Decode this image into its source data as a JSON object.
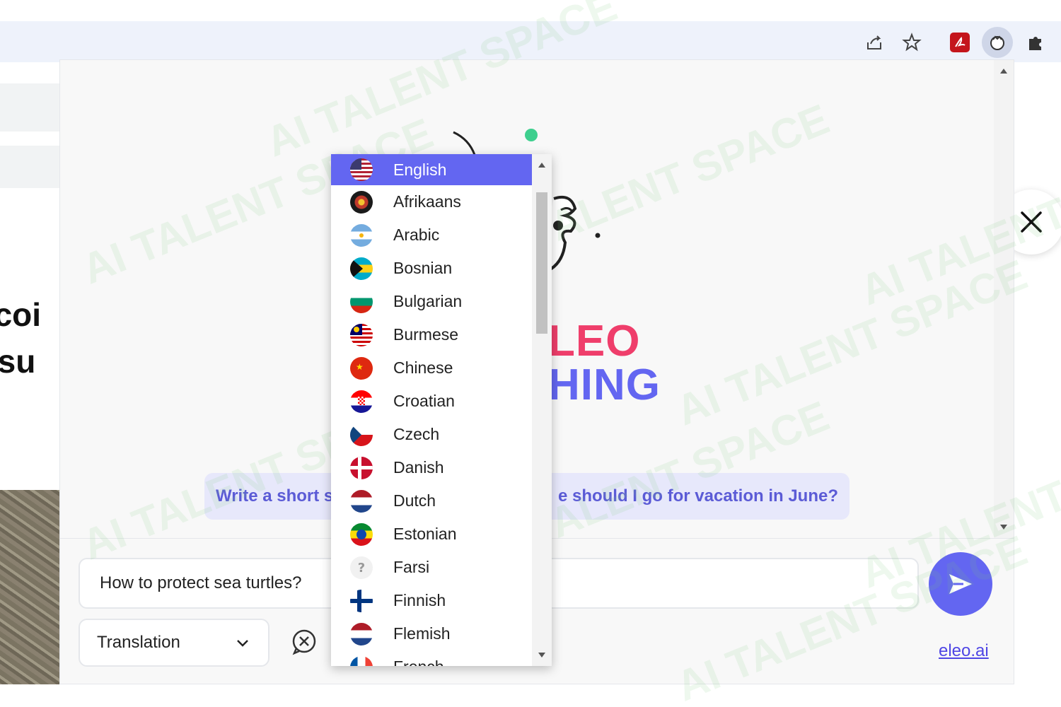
{
  "colors": {
    "accent": "#6366f1",
    "brand_red": "#ef3e6b",
    "chip_bg": "#e7e8fb",
    "selected_item": "#6366f1"
  },
  "toolbar": {
    "icons": [
      "share-icon",
      "bookmark-star-icon",
      "pdf-extension-icon",
      "eleo-extension-icon",
      "extensions-puzzle-icon"
    ]
  },
  "underlying_page": {
    "heading_line1": "ecoi",
    "heading_line2": "r su"
  },
  "panel": {
    "logo_line1": "LEO",
    "logo_line2": "HING",
    "suggestion_left": "Write a short s",
    "suggestion_right": "e should I go for vacation in June?",
    "input_value": "How to protect sea turtles?",
    "mode_value": "Translation",
    "footer_link": "eleo.ai"
  },
  "language_dropdown": {
    "selected": "English",
    "options": [
      {
        "label": "English",
        "flag": "us-flag-icon"
      },
      {
        "label": "Afrikaans",
        "flag": "za-flag-icon"
      },
      {
        "label": "Arabic",
        "flag": "ar-flag-icon"
      },
      {
        "label": "Bosnian",
        "flag": "bs-flag-icon"
      },
      {
        "label": "Bulgarian",
        "flag": "bg-flag-icon"
      },
      {
        "label": "Burmese",
        "flag": "my-flag-icon"
      },
      {
        "label": "Chinese",
        "flag": "cn-flag-icon"
      },
      {
        "label": "Croatian",
        "flag": "hr-flag-icon"
      },
      {
        "label": "Czech",
        "flag": "cz-flag-icon"
      },
      {
        "label": "Danish",
        "flag": "dk-flag-icon"
      },
      {
        "label": "Dutch",
        "flag": "nl-flag-icon"
      },
      {
        "label": "Estonian",
        "flag": "ee-flag-icon"
      },
      {
        "label": "Farsi",
        "flag": "unknown-flag-icon"
      },
      {
        "label": "Finnish",
        "flag": "fi-flag-icon"
      },
      {
        "label": "Flemish",
        "flag": "be-flag-icon"
      },
      {
        "label": "French",
        "flag": "fr-flag-icon"
      }
    ]
  },
  "watermark": "AI TALENT SPACE"
}
